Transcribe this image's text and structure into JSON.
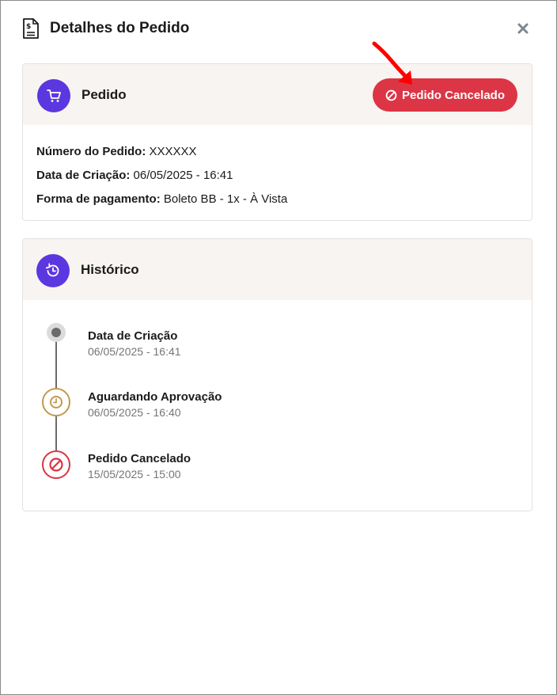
{
  "header": {
    "title": "Detalhes do Pedido",
    "icon": "invoice-dollar-icon",
    "close_icon": "close-icon"
  },
  "order_card": {
    "title": "Pedido",
    "icon": "cart-icon",
    "status_label": "Pedido Cancelado",
    "status_icon": "ban-icon",
    "status_color": "#dc3545",
    "fields": [
      {
        "label": "Número do Pedido:",
        "value": "XXXXXX"
      },
      {
        "label": "Data de Criação:",
        "value": "06/05/2025 - 16:41"
      },
      {
        "label": "Forma de pagamento:",
        "value": "Boleto BB - 1x - À Vista"
      }
    ]
  },
  "history_card": {
    "title": "Histórico",
    "icon": "history-icon",
    "events": [
      {
        "title": "Data de Criação",
        "date": "06/05/2025 - 16:41",
        "icon": "dot-icon",
        "color": "#6b6b6b"
      },
      {
        "title": "Aguardando Aprovação",
        "date": "06/05/2025 - 16:40",
        "icon": "clock-icon",
        "color": "#c19a4f"
      },
      {
        "title": "Pedido Cancelado",
        "date": "15/05/2025 - 15:00",
        "icon": "ban-icon",
        "color": "#dc3545"
      }
    ]
  },
  "colors": {
    "accent": "#5b37e0",
    "card_header_bg": "#f8f4f1",
    "annotation_arrow": "#ff0000"
  }
}
